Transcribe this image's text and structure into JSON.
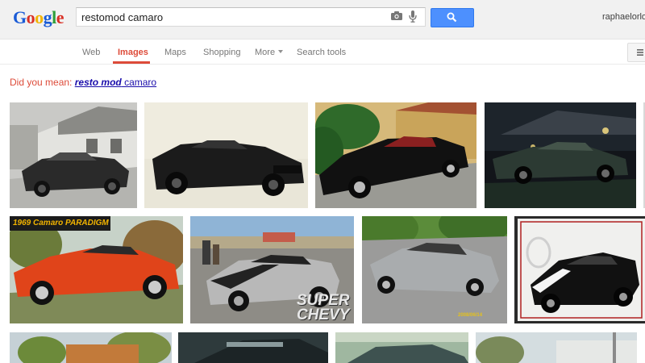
{
  "logo": {
    "letters": [
      "G",
      "o",
      "o",
      "g",
      "l",
      "e"
    ],
    "colors": [
      "#1a5bd6",
      "#d93025",
      "#f2b400",
      "#1a5bd6",
      "#2e9e3a",
      "#d93025"
    ]
  },
  "search": {
    "query": "restomod camaro",
    "placeholder": ""
  },
  "user": {
    "name": "raphaelorlove"
  },
  "nav": {
    "tabs": [
      {
        "label": "Web"
      },
      {
        "label": "Images",
        "active": true
      },
      {
        "label": "Maps"
      },
      {
        "label": "Shopping"
      },
      {
        "label": "More"
      },
      {
        "label": "Search tools"
      }
    ]
  },
  "suggestion": {
    "prefix": "Did you mean: ",
    "bold1": "resto",
    "bold2": "mod",
    "rest": " camaro"
  },
  "thumbnails": {
    "row1": [
      "black camaro in driveway",
      "black camaro on light wall",
      "black camaro with red interior",
      "dark camaro at night"
    ],
    "row2": [
      "orange camaro",
      "silver camaro at car show",
      "silver camaro on asphalt",
      "black camaro with white stripes"
    ],
    "watermarks": {
      "orange_banner": "1969 Camaro PARADIGM",
      "super_chevy": "SUPER CHEVY",
      "date_stamp": "2008/06/14"
    }
  },
  "colors": {
    "accent_red": "#dd4b39",
    "link_blue": "#1a0dab",
    "button_blue": "#4d90fe"
  }
}
